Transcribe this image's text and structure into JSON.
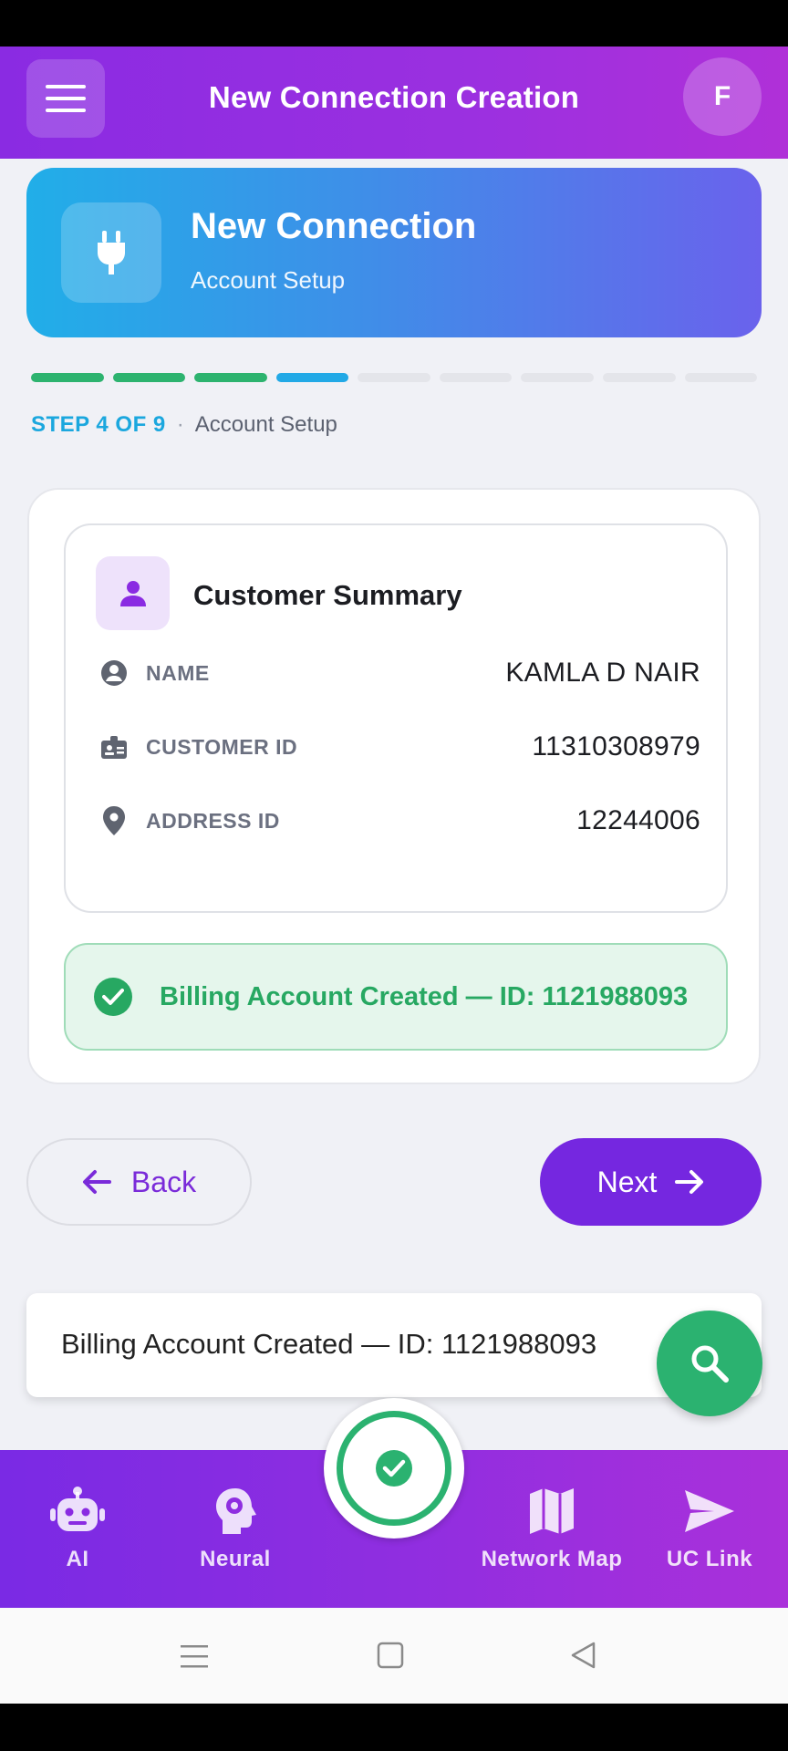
{
  "app": {
    "title": "New Connection Creation",
    "avatar_initial": "F"
  },
  "hero": {
    "title": "New Connection",
    "subtitle": "Account Setup",
    "icon": "plug-icon"
  },
  "progress": {
    "current_step": 4,
    "total_steps": 9,
    "step_label": "STEP 4 OF 9",
    "step_name": "Account Setup"
  },
  "summary": {
    "title": "Customer Summary",
    "rows": [
      {
        "label": "NAME",
        "value": "KAMLA D NAIR",
        "icon": "person-circle-icon"
      },
      {
        "label": "CUSTOMER ID",
        "value": "11310308979",
        "icon": "id-badge-icon"
      },
      {
        "label": "ADDRESS ID",
        "value": "12244006",
        "icon": "location-pin-icon"
      }
    ]
  },
  "status": {
    "message": "Billing Account Created — ID: 1121988093"
  },
  "actions": {
    "back_label": "Back",
    "next_label": "Next"
  },
  "search": {
    "value": "Billing Account Created — ID: 1121988093"
  },
  "bottom_nav": [
    {
      "label": "AI",
      "icon": "robot-icon"
    },
    {
      "label": "Neural",
      "icon": "brain-icon"
    },
    {
      "label": "",
      "icon": "check-circle-icon"
    },
    {
      "label": "Network Map",
      "icon": "map-icon"
    },
    {
      "label": "UC Link",
      "icon": "send-icon"
    }
  ],
  "colors": {
    "primary": "#7527e0",
    "success": "#27a862",
    "accent_blue": "#22a9e6"
  }
}
